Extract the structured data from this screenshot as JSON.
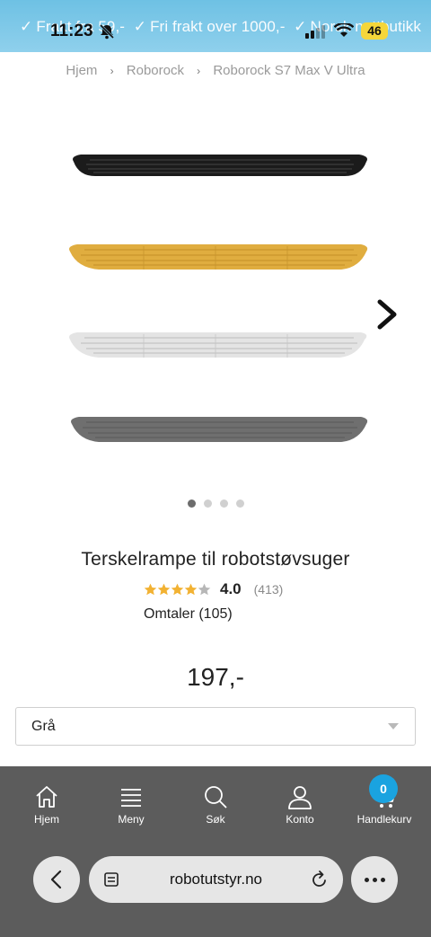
{
  "banner": {
    "messages": [
      "Frakt fra 59,-",
      "Fri frakt over 1000,-",
      "Norsk nettbutikk"
    ]
  },
  "status_bar": {
    "time": "11:23",
    "battery": "46"
  },
  "breadcrumb": {
    "items": [
      "Hjem",
      "Roborock",
      "Roborock S7 Max V Ultra"
    ]
  },
  "product": {
    "title": "Terskelrampe til robotstøvsuger",
    "rating_value": "4.0",
    "rating_count": "(413)",
    "rating_stars": 4,
    "reviews_label": "Omtaler (105)",
    "price": "197,-",
    "variant_selected": "Grå",
    "image_colors": [
      "#1b1b1b",
      "#e0ad3f",
      "#dcdcdc",
      "#6f6f6f"
    ],
    "carousel_total": 4,
    "carousel_active": 1
  },
  "bottom_nav": {
    "items": [
      {
        "label": "Hjem",
        "icon": "home-icon"
      },
      {
        "label": "Meny",
        "icon": "menu-icon"
      },
      {
        "label": "Søk",
        "icon": "search-icon"
      },
      {
        "label": "Konto",
        "icon": "account-icon"
      },
      {
        "label": "Handlekurv",
        "icon": "cart-icon"
      }
    ],
    "cart_count": "0"
  },
  "browser": {
    "url": "robotutstyr.no"
  },
  "colors": {
    "banner": "#6ec1e4",
    "nav_bg": "#5c5c5c",
    "badge": "#1aa3e0",
    "star": "#f2b233"
  }
}
